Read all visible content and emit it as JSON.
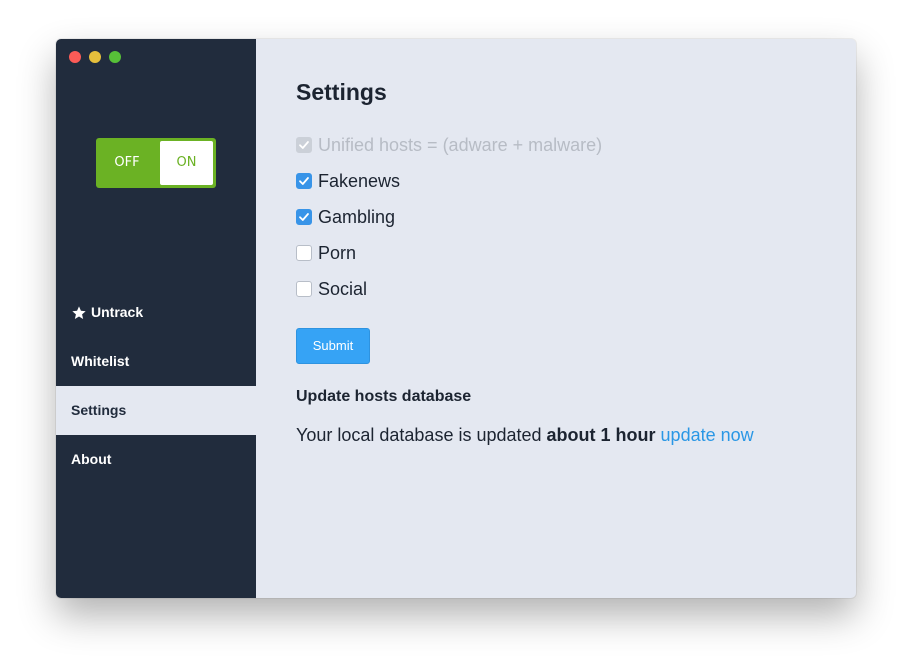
{
  "toggle": {
    "off_label": "OFF",
    "on_label": "ON",
    "state": "on"
  },
  "sidebar": {
    "items": [
      {
        "label": "Untrack",
        "icon": "star-icon",
        "active": false
      },
      {
        "label": "Whitelist",
        "active": false
      },
      {
        "label": "Settings",
        "active": true
      },
      {
        "label": "About",
        "active": false
      }
    ]
  },
  "main": {
    "title": "Settings",
    "options": [
      {
        "label": "Unified hosts = (adware + malware)",
        "checked": true,
        "disabled": true
      },
      {
        "label": "Fakenews",
        "checked": true,
        "disabled": false
      },
      {
        "label": "Gambling",
        "checked": true,
        "disabled": false
      },
      {
        "label": "Porn",
        "checked": false,
        "disabled": false
      },
      {
        "label": "Social",
        "checked": false,
        "disabled": false
      }
    ],
    "submit_label": "Submit",
    "update_heading": "Update hosts database",
    "update_text_prefix": "Your local database is updated ",
    "update_text_bold": "about 1 hour",
    "update_link": "update now"
  },
  "colors": {
    "sidebar_bg": "#212c3d",
    "main_bg": "#e4e8f1",
    "toggle_green": "#6bb224",
    "accent_blue": "#36a3f5",
    "link_blue": "#2a97e5"
  }
}
